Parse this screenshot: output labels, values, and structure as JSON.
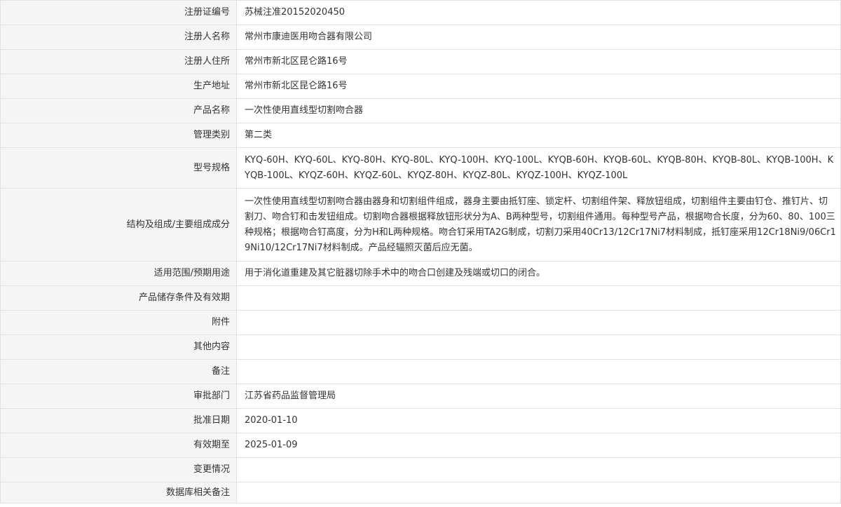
{
  "rows": [
    {
      "label": "注册证编号",
      "value": "苏械注准20152020450"
    },
    {
      "label": "注册人名称",
      "value": "常州市康迪医用吻合器有限公司"
    },
    {
      "label": "注册人住所",
      "value": "常州市新北区昆仑路16号"
    },
    {
      "label": "生产地址",
      "value": "常州市新北区昆仑路16号"
    },
    {
      "label": "产品名称",
      "value": "一次性使用直线型切割吻合器"
    },
    {
      "label": "管理类别",
      "value": "第二类"
    },
    {
      "label": "型号规格",
      "value": "KYQ-60H、KYQ-60L、KYQ-80H、KYQ-80L、KYQ-100H、KYQ-100L、KYQB-60H、KYQB-60L、KYQB-80H、KYQB-80L、KYQB-100H、KYQB-100L、KYQZ-60H、KYQZ-60L、KYQZ-80H、KYQZ-80L、KYQZ-100H、KYQZ-100L"
    },
    {
      "label": "结构及组成/主要组成成分",
      "value": "一次性使用直线型切割吻合器由器身和切割组件组成，器身主要由抵钉座、锁定杆、切割组件架、释放钮组成，切割组件主要由钉仓、推钉片、切割刀、吻合钉和击发钮组成。切割吻合器根据释放钮形状分为A、B两种型号，切割组件通用。每种型号产品，根据吻合长度，分为60、80、100三种规格；根据吻合钉高度，分为H和L两种规格。吻合钉采用TA2G制成，切割刀采用40Cr13/12Cr17Ni7材料制成，抵钉座采用12Cr18Ni9/06Cr19Ni10/12Cr17Ni7材料制成。产品经辐照灭菌后应无菌。"
    },
    {
      "label": "适用范围/预期用途",
      "value": "用于消化道重建及其它脏器切除手术中的吻合口创建及残端或切口的闭合。"
    },
    {
      "label": "产品储存条件及有效期",
      "value": ""
    },
    {
      "label": "附件",
      "value": ""
    },
    {
      "label": "其他内容",
      "value": ""
    },
    {
      "label": "备注",
      "value": ""
    },
    {
      "label": "审批部门",
      "value": "江苏省药品监督管理局"
    },
    {
      "label": "批准日期",
      "value": "2020-01-10"
    },
    {
      "label": "有效期至",
      "value": "2025-01-09"
    },
    {
      "label": "变更情况",
      "value": ""
    },
    {
      "label": "数据库相关备注",
      "value": ""
    }
  ]
}
